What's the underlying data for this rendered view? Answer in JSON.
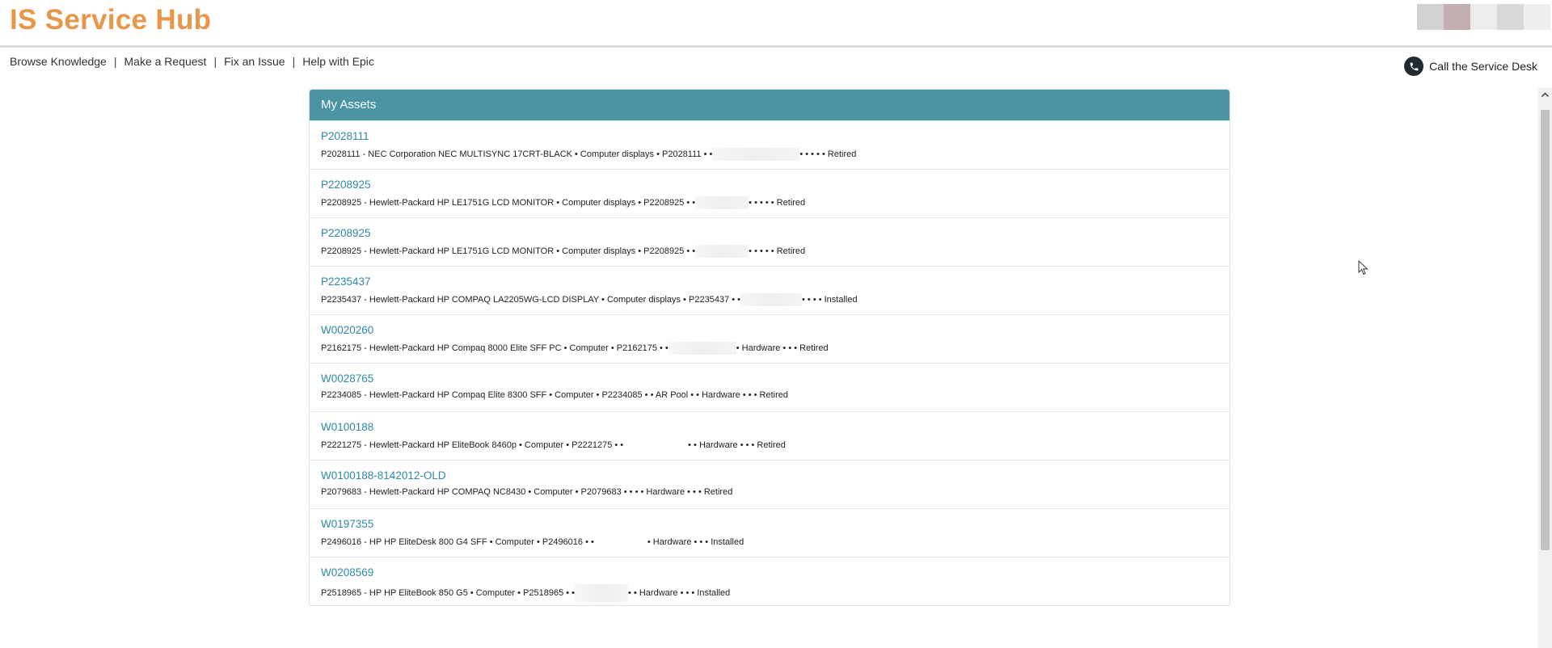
{
  "header": {
    "brand": "IS Service Hub"
  },
  "nav": {
    "items": [
      {
        "label": "Browse Knowledge"
      },
      {
        "label": "Make a Request"
      },
      {
        "label": "Fix an Issue"
      },
      {
        "label": "Help with Epic"
      }
    ],
    "separator": "|"
  },
  "call_desk": {
    "label": "Call the Service Desk",
    "icon": "phone-icon"
  },
  "panel": {
    "title": "My Assets",
    "accent_color": "#4a94a4",
    "link_color": "#2f88a8",
    "assets": [
      {
        "tag": "P2028111",
        "detail_a": "P2028111 - NEC Corporation NEC MULTISYNC 17CRT-BLACK • Computer displays • P2028111 • •",
        "detail_b": "• • • • • Retired"
      },
      {
        "tag": "P2208925",
        "detail_a": "P2208925 - Hewlett-Packard HP LE1751G LCD MONITOR • Computer displays • P2208925 • •",
        "detail_b": "• • • • • Retired"
      },
      {
        "tag": "P2208925",
        "detail_a": "P2208925 - Hewlett-Packard HP LE1751G LCD MONITOR • Computer displays • P2208925 • •",
        "detail_b": "• • • • • Retired"
      },
      {
        "tag": "P2235437",
        "detail_a": "P2235437 - Hewlett-Packard HP COMPAQ LA2205WG-LCD DISPLAY • Computer displays • P2235437 • •",
        "detail_b": "• • • • Installed"
      },
      {
        "tag": "W0020260",
        "detail_a": "P2162175 - Hewlett-Packard HP Compaq 8000 Elite SFF PC • Computer • P2162175 • •",
        "detail_b": "• Hardware • • • Retired"
      },
      {
        "tag": "W0028765",
        "detail_a": "P2234085 - Hewlett-Packard HP Compaq Elite 8300 SFF • Computer • P2234085 • • AR Pool • • Hardware • • • Retired",
        "detail_b": ""
      },
      {
        "tag": "W0100188",
        "detail_a": "P2221275 - Hewlett-Packard HP EliteBook 8460p • Computer • P2221275 • •",
        "detail_b": "• • Hardware • • • Retired"
      },
      {
        "tag": "W0100188-8142012-OLD",
        "detail_a": "P2079683 - Hewlett-Packard HP COMPAQ NC8430 • Computer • P2079683 • • • • Hardware • • • Retired",
        "detail_b": ""
      },
      {
        "tag": "W0197355",
        "detail_a": "P2496016 - HP HP EliteDesk 800 G4 SFF • Computer • P2496016 • •",
        "detail_b": "• Hardware • • • Installed"
      },
      {
        "tag": "W0208569",
        "detail_a": "P2518965 - HP HP EliteBook 850 G5 • Computer • P2518965 • •",
        "detail_b": "• • Hardware • • • Installed"
      }
    ]
  },
  "colors": {
    "brand": "#e8964a",
    "header_bg": "#4a94a4"
  }
}
